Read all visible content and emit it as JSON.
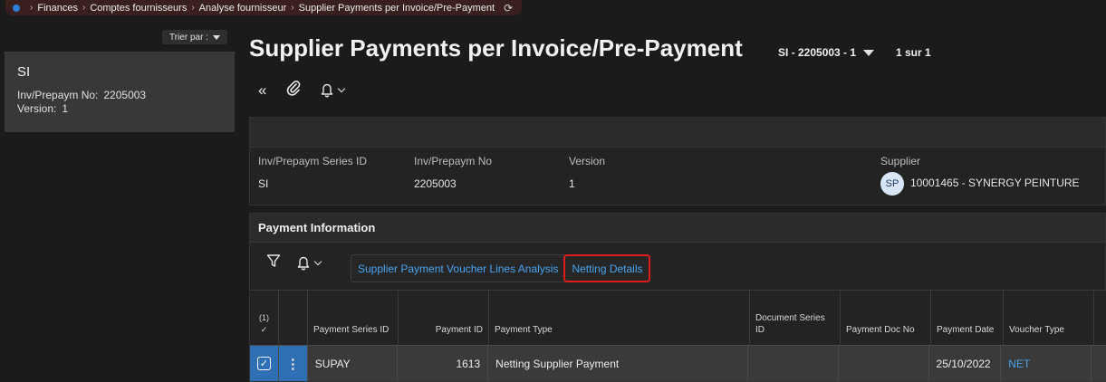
{
  "breadcrumb": {
    "items": [
      "Finances",
      "Comptes fournisseurs",
      "Analyse fournisseur",
      "Supplier Payments per Invoice/Pre-Payment"
    ]
  },
  "sidebar": {
    "sort_label": "Trier par :",
    "card": {
      "title": "SI",
      "fields": [
        {
          "label": "Inv/Prepaym No:",
          "value": "2205003"
        },
        {
          "label": "Version:",
          "value": "1"
        }
      ]
    }
  },
  "page": {
    "title": "Supplier Payments per Invoice/Pre-Payment",
    "record": "SI - 2205003 - 1",
    "pager": "1 sur 1"
  },
  "header": {
    "fields": [
      {
        "label": "Inv/Prepaym Series ID",
        "value": "SI"
      },
      {
        "label": "Inv/Prepaym No",
        "value": "2205003"
      },
      {
        "label": "Version",
        "value": "1"
      },
      {
        "label": "Supplier",
        "value": "10001465 - SYNERGY PEINTURE",
        "avatar": "SP"
      }
    ]
  },
  "payment": {
    "title": "Payment Information",
    "tabs": [
      "Supplier Payment Voucher Lines Analysis",
      "Netting Details"
    ],
    "selected_count": "(1)",
    "columns": [
      "Payment Series ID",
      "Payment ID",
      "Payment Type",
      "Document Series ID",
      "Payment Doc No",
      "Payment Date",
      "Voucher Type"
    ],
    "rows": [
      {
        "series": "SUPAY",
        "id": "1613",
        "type": "Netting Supplier Payment",
        "doc_series": "",
        "doc_no": "",
        "date": "25/10/2022",
        "voucher": "NET"
      }
    ]
  },
  "colors": {
    "accent": "#4aa3f0",
    "highlight": "#e01b1b",
    "selection": "#2f6fb3"
  }
}
